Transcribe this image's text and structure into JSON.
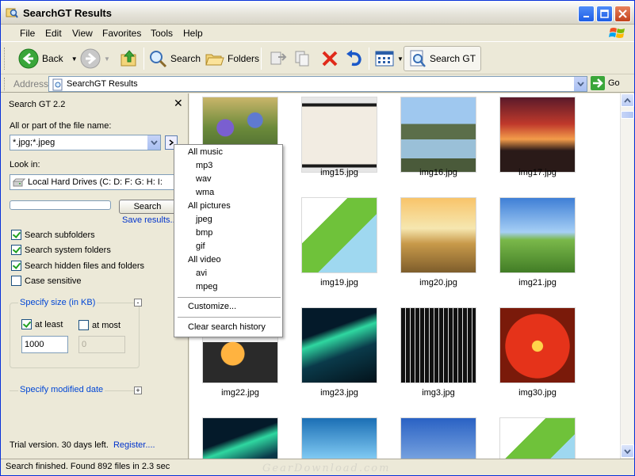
{
  "window": {
    "title": "SearchGT Results"
  },
  "menu": [
    "File",
    "Edit",
    "View",
    "Favorites",
    "Tools",
    "Help"
  ],
  "toolbar": {
    "back": "Back",
    "search": "Search",
    "folders": "Folders",
    "searchgt": "Search GT"
  },
  "address": {
    "label": "Address",
    "value": "SearchGT Results",
    "go": "Go"
  },
  "panel": {
    "title": "Search GT 2.2",
    "filename_label": "All or part of the file name:",
    "filename_value": "*.jpg;*.jpeg",
    "lookin_label": "Look in:",
    "lookin_value": "Local Hard Drives (C: D: F: G: H: I:",
    "search_button": "Search",
    "save_results": "Save results...",
    "options": [
      {
        "label": "Search subfolders",
        "checked": true
      },
      {
        "label": "Search system folders",
        "checked": true
      },
      {
        "label": "Search hidden files and folders",
        "checked": true
      },
      {
        "label": "Case sensitive",
        "checked": false
      }
    ],
    "size_group": "Specify size (in KB)",
    "at_least_label": "at least",
    "at_least_checked": true,
    "at_least_value": "1000",
    "at_most_label": "at most",
    "at_most_checked": false,
    "at_most_value": "0",
    "date_group": "Specify modified date",
    "trial_text": "Trial version. 30 days left.",
    "register": "Register...."
  },
  "popup_menu": {
    "items": [
      "All music",
      "mp3",
      "wav",
      "wma",
      "All pictures",
      "jpeg",
      "bmp",
      "gif",
      "All video",
      "avi",
      "mpeg"
    ],
    "customize": "Customize...",
    "clear_history": "Clear search history"
  },
  "thumbnails": [
    {
      "label": "",
      "theme": "iris"
    },
    {
      "label": "img15.jpg",
      "theme": "koi"
    },
    {
      "label": "img16.jpg",
      "theme": "lake"
    },
    {
      "label": "img17.jpg",
      "theme": "sunset"
    },
    {
      "label": "",
      "theme": "leaf"
    },
    {
      "label": "img19.jpg",
      "theme": "leaf"
    },
    {
      "label": "img20.jpg",
      "theme": "field"
    },
    {
      "label": "img21.jpg",
      "theme": "meadow"
    },
    {
      "label": "img22.jpg",
      "theme": "fire"
    },
    {
      "label": "img23.jpg",
      "theme": "aurora"
    },
    {
      "label": "img3.jpg",
      "theme": "city"
    },
    {
      "label": "img30.jpg",
      "theme": "flower"
    },
    {
      "label": "",
      "theme": "aurora"
    },
    {
      "label": "",
      "theme": "reef"
    },
    {
      "label": "",
      "theme": "sky"
    },
    {
      "label": "",
      "theme": "leaf"
    }
  ],
  "status": {
    "text": "Search finished. Found 892 files in 2.3 sec",
    "watermark": "GearDownload.com"
  }
}
